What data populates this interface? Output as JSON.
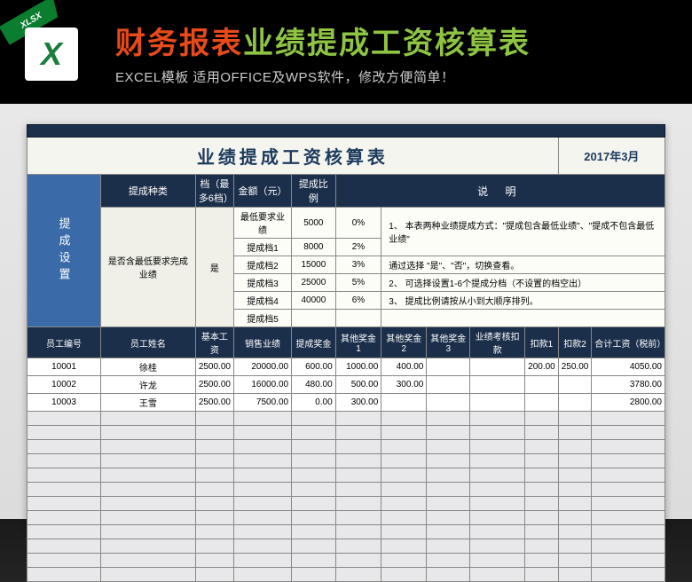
{
  "banner": {
    "ribbon": "XLSX",
    "title_a": "财务报表",
    "title_b": "业绩提成工资核算表",
    "subtitle": "EXCEL模板 适用OFFICE及WPS软件，修改方便简单！"
  },
  "sheet": {
    "title": "业绩提成工资核算表",
    "date": "2017年3月",
    "side_label": "提成设置",
    "cfg_headers": {
      "type": "提成种类",
      "tier": "档（最多6档）",
      "amount": "金额（元）",
      "ratio": "提成比例"
    },
    "include_label": "是否含最低要求完成业绩",
    "include_value": "是",
    "tiers": [
      {
        "name": "最低要求业绩",
        "amount": "5000",
        "ratio": "0%"
      },
      {
        "name": "提成档1",
        "amount": "8000",
        "ratio": "2%"
      },
      {
        "name": "提成档2",
        "amount": "15000",
        "ratio": "3%"
      },
      {
        "name": "提成档3",
        "amount": "25000",
        "ratio": "5%"
      },
      {
        "name": "提成档4",
        "amount": "40000",
        "ratio": "6%"
      },
      {
        "name": "提成档5",
        "amount": "",
        "ratio": ""
      }
    ],
    "notes_title": "说   明",
    "notes": [
      "1、 本表两种业绩提成方式：\"提成包含最低业绩\"、\"提成不包含最低业绩\"",
      "       通过选择 \"是\"、\"否\"，切换查看。",
      "2、 可选择设置1-6个提成分档（不设置的档空出）",
      "3、 提成比例请按从小到大顺序排列。"
    ],
    "cols": [
      "员工编号",
      "员工姓名",
      "基本工资",
      "销售业绩",
      "提成奖金",
      "其他奖金1",
      "其他奖金2",
      "其他奖金3",
      "业绩考核扣款",
      "扣款1",
      "扣款2",
      "合计工资（税前）"
    ],
    "rows": [
      {
        "id": "10001",
        "name": "徐桂",
        "base": "2500.00",
        "sales": "20000.00",
        "bonus": "600.00",
        "o1": "1000.00",
        "o2": "400.00",
        "o3": "",
        "kpi": "",
        "d1": "200.00",
        "d2": "250.00",
        "total": "4050.00"
      },
      {
        "id": "10002",
        "name": "许龙",
        "base": "2500.00",
        "sales": "16000.00",
        "bonus": "480.00",
        "o1": "500.00",
        "o2": "300.00",
        "o3": "",
        "kpi": "",
        "d1": "",
        "d2": "",
        "total": "3780.00"
      },
      {
        "id": "10003",
        "name": "王雪",
        "base": "2500.00",
        "sales": "7500.00",
        "bonus": "0.00",
        "o1": "300.00",
        "o2": "",
        "o3": "",
        "kpi": "",
        "d1": "",
        "d2": "",
        "total": "2800.00"
      }
    ]
  }
}
